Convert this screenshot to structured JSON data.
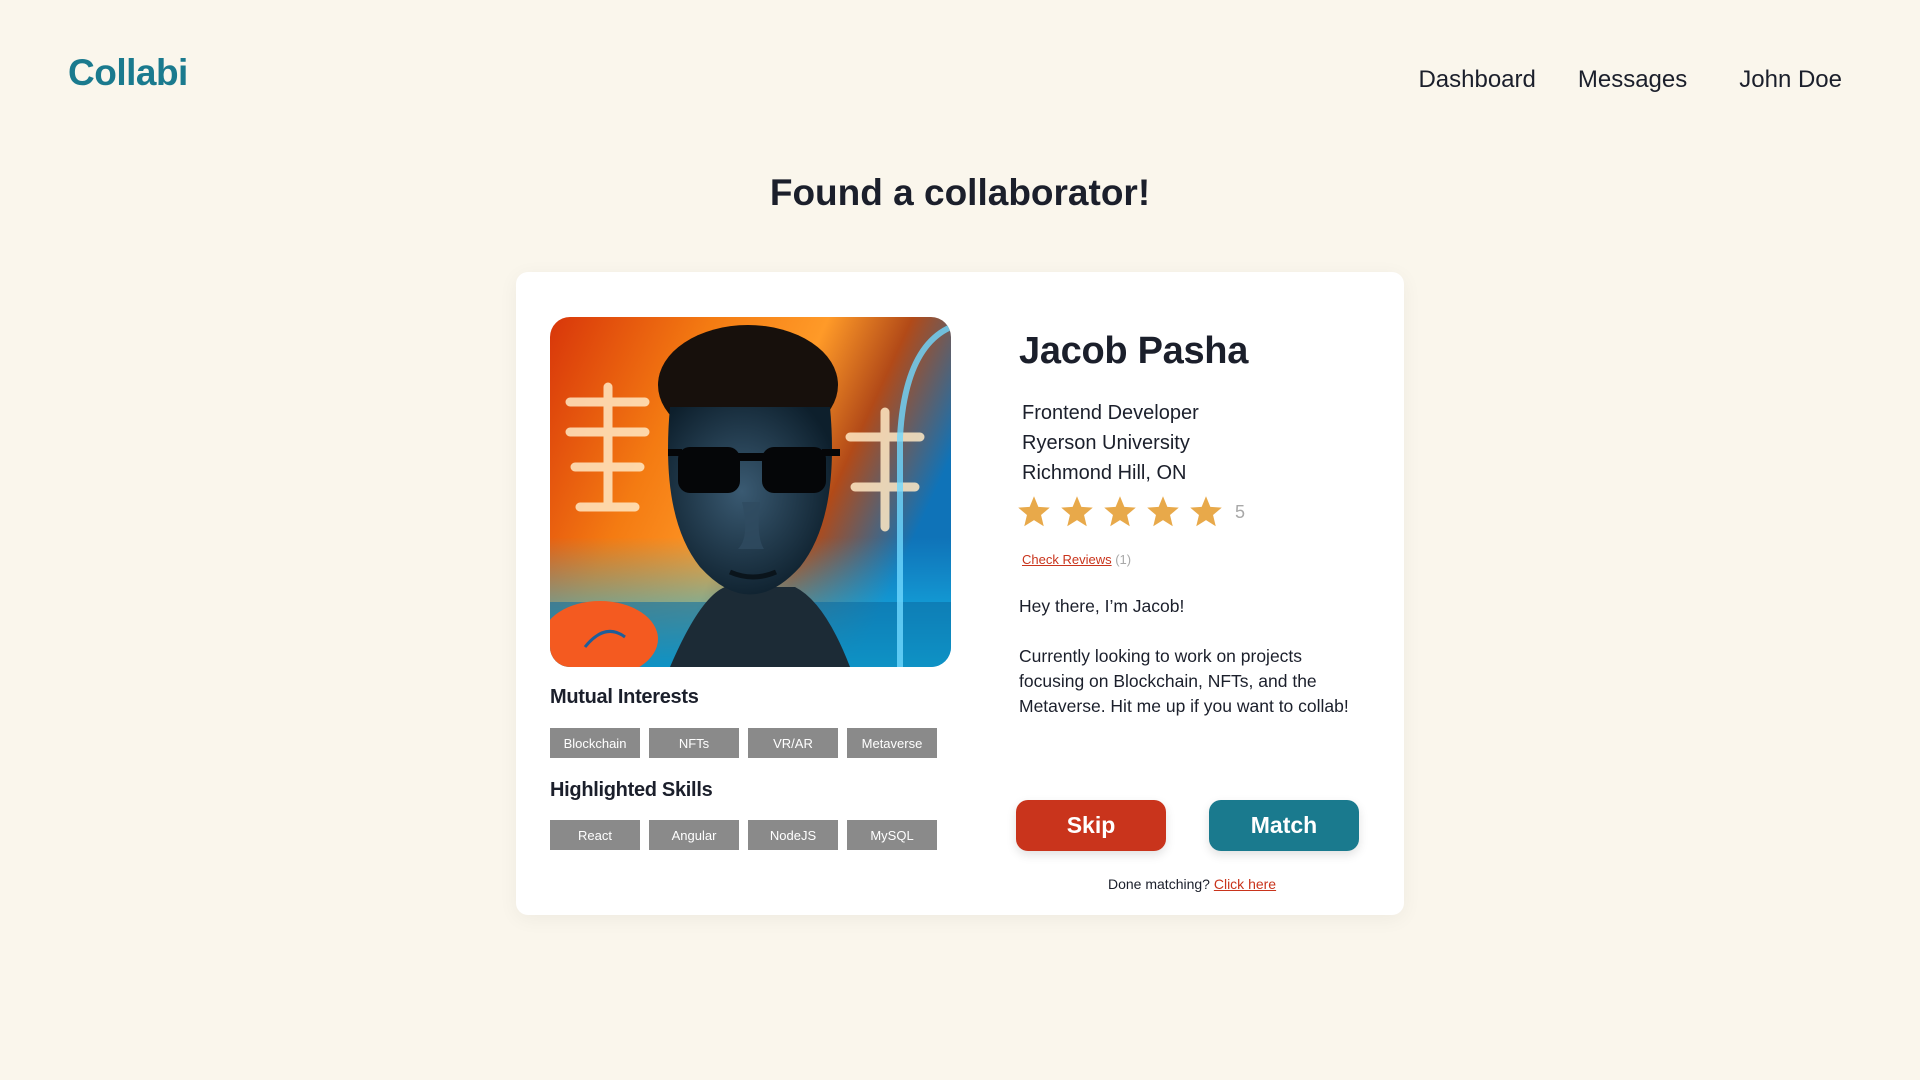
{
  "header": {
    "logo": "Collabi",
    "nav": [
      "Dashboard",
      "Messages",
      "John Doe"
    ]
  },
  "heading": "Found a collaborator!",
  "profile": {
    "name": "Jacob Pasha",
    "role": "Frontend Developer",
    "school": "Ryerson University",
    "location": "Richmond Hill, ON",
    "rating": 5,
    "rating_label": "5",
    "reviews_link": "Check Reviews",
    "reviews_count": "(1)",
    "bio_1": "Hey there, I’m Jacob!",
    "bio_2": "Currently looking to work on projects focusing on Blockchain, NFTs, and the Metaverse. Hit me up if you want to collab!"
  },
  "mutual_interests": {
    "title": "Mutual Interests",
    "tags": [
      "Blockchain",
      "NFTs",
      "VR/AR",
      "Metaverse"
    ]
  },
  "highlighted_skills": {
    "title": "Highlighted Skills",
    "tags": [
      "React",
      "Angular",
      "NodeJS",
      "MySQL"
    ]
  },
  "actions": {
    "skip": "Skip",
    "match": "Match",
    "done_text": "Done matching?",
    "done_link": "Click here"
  },
  "colors": {
    "brand": "#1a7a8e",
    "skip": "#c9341c",
    "star": "#e8a94a",
    "tag": "#8a8a8a",
    "background": "#faf6ec"
  }
}
